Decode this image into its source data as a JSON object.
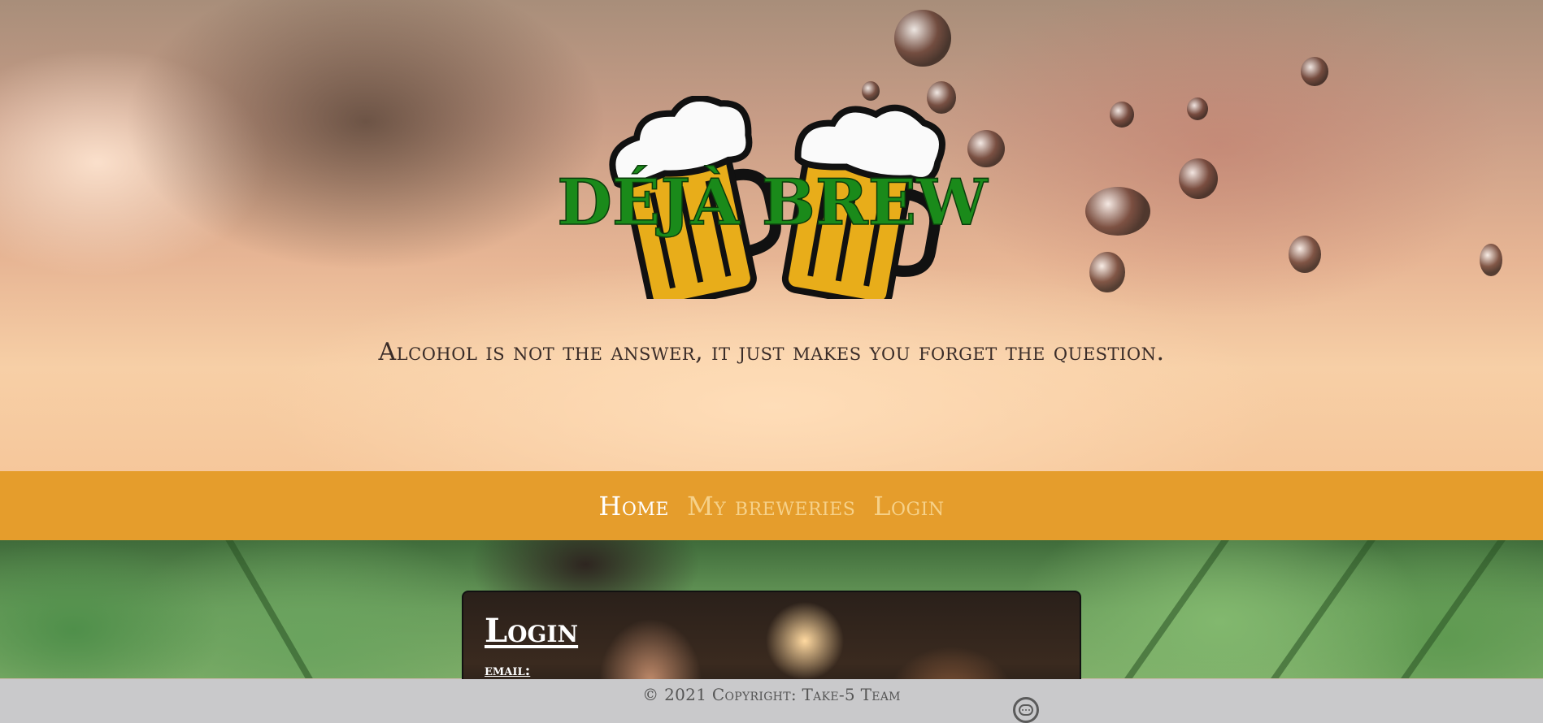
{
  "header": {
    "logo_text": "DÉJÀ BREW",
    "tagline": "Alcohol is not the answer, it just makes you forget the question."
  },
  "nav": {
    "items": [
      {
        "label": "Home",
        "active": true
      },
      {
        "label": "My breweries",
        "active": false
      },
      {
        "label": "Login",
        "active": false
      }
    ]
  },
  "login_card": {
    "title": "Login",
    "email_label": "email:"
  },
  "footer": {
    "copyright": "© 2021 Copyright: Take-5 Team",
    "chat_icon": "chat-bubble-icon"
  },
  "colors": {
    "nav_bg": "#e59d2c",
    "nav_active": "#ffffff",
    "nav_inactive": "#f6d189",
    "logo_green": "#1a8a1a",
    "mug_gold": "#e8ad1a",
    "footer_bg": "#c9c9cb"
  }
}
